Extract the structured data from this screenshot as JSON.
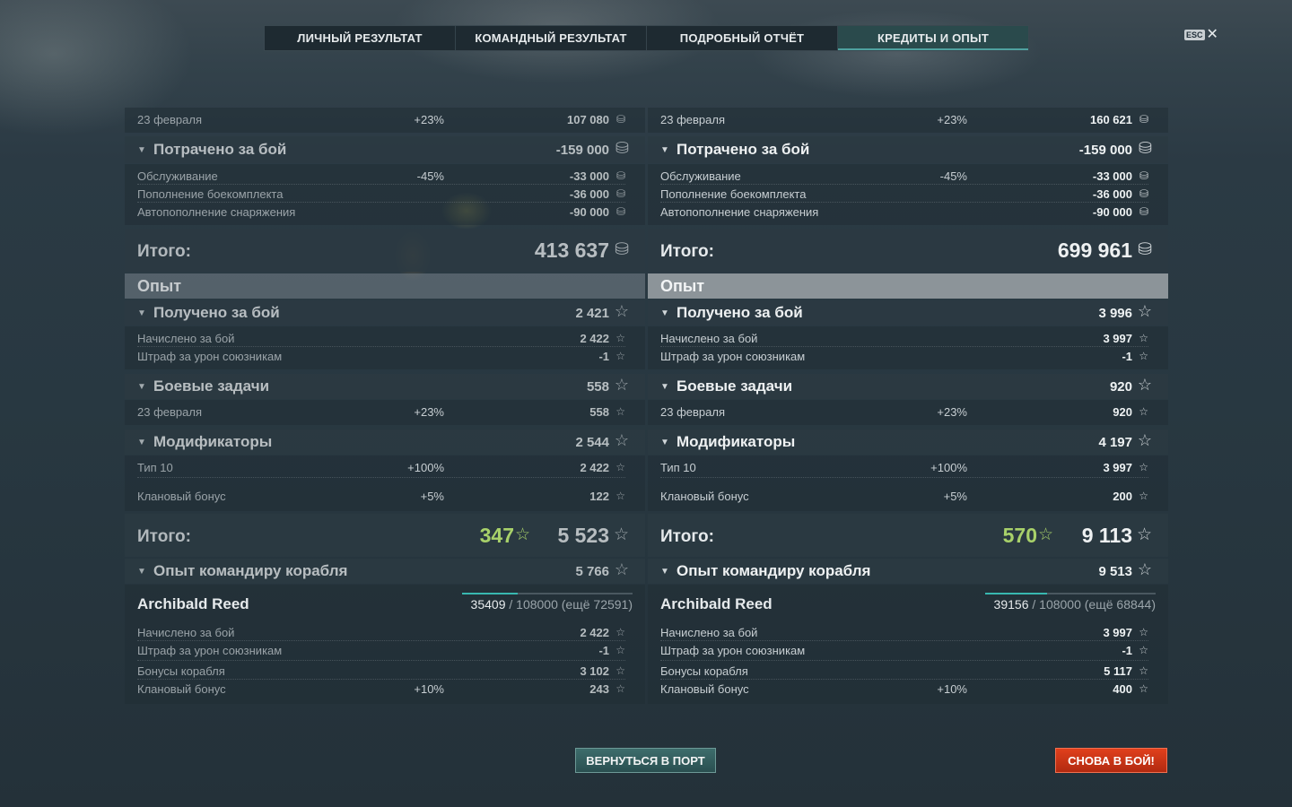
{
  "tabs": [
    {
      "label": "ЛИЧНЫЙ РЕЗУЛЬТАТ"
    },
    {
      "label": "КОМАНДНЫЙ РЕЗУЛЬТАТ"
    },
    {
      "label": "ПОДРОБНЫЙ ОТЧЁТ"
    },
    {
      "label": "КРЕДИТЫ И ОПЫТ"
    }
  ],
  "active_tab": "КРЕДИТЫ И ОПЫТ",
  "esc": {
    "key": "ESC",
    "close": "✕"
  },
  "icons": {
    "credit": "credit-coin-icon",
    "xp": "xp-star-icon"
  },
  "left": {
    "feb23": {
      "label": "23 февраля",
      "pct": "+23%",
      "value": "107 080"
    },
    "spent": {
      "label": "Потрачено за бой",
      "value": "-159 000"
    },
    "service": {
      "label": "Обслуживание",
      "pct": "-45%",
      "value": "-33 000"
    },
    "ammo": {
      "label": "Пополнение боекомплекта",
      "value": "-36 000"
    },
    "consumables": {
      "label": "Автопополнение снаряжения",
      "value": "-90 000"
    },
    "credits_total": {
      "label": "Итого:",
      "value": "413 637"
    },
    "xp_section": "Опыт",
    "earned": {
      "label": "Получено за бой",
      "value": "2 421"
    },
    "accrued": {
      "label": "Начислено за бой",
      "value": "2 422"
    },
    "penalty": {
      "label": "Штраф за урон союзникам",
      "value": "-1"
    },
    "missions": {
      "label": "Боевые задачи",
      "value": "558"
    },
    "missions_feb23": {
      "label": "23 февраля",
      "pct": "+23%",
      "value": "558"
    },
    "modifiers": {
      "label": "Модификаторы",
      "value": "2 544"
    },
    "tier": {
      "label": "Тип 10",
      "pct": "+100%",
      "value": "2 422"
    },
    "clan": {
      "label": "Клановый бонус",
      "pct": "+5%",
      "value": "122"
    },
    "xp_total": {
      "label": "Итого:",
      "free_xp": "347",
      "value": "5 523"
    },
    "commander": {
      "label": "Опыт командиру корабля",
      "value": "5 766"
    },
    "captain": {
      "name": "Archibald Reed",
      "current": "35409",
      "rest": "/ 108000 (ещё 72591)",
      "progress": 0.3279
    },
    "c_accrued": {
      "label": "Начислено за бой",
      "value": "2 422"
    },
    "c_penalty": {
      "label": "Штраф за урон союзникам",
      "value": "-1"
    },
    "c_ship": {
      "label": "Бонусы корабля",
      "value": "3 102"
    },
    "c_clan": {
      "label": "Клановый бонус",
      "pct": "+10%",
      "value": "243"
    }
  },
  "right": {
    "feb23": {
      "label": "23 февраля",
      "pct": "+23%",
      "value": "160 621"
    },
    "spent": {
      "label": "Потрачено за бой",
      "value": "-159 000"
    },
    "service": {
      "label": "Обслуживание",
      "pct": "-45%",
      "value": "-33 000"
    },
    "ammo": {
      "label": "Пополнение боекомплекта",
      "value": "-36 000"
    },
    "consumables": {
      "label": "Автопополнение снаряжения",
      "value": "-90 000"
    },
    "credits_total": {
      "label": "Итого:",
      "value": "699 961"
    },
    "xp_section": "Опыт",
    "earned": {
      "label": "Получено за бой",
      "value": "3 996"
    },
    "accrued": {
      "label": "Начислено за бой",
      "value": "3 997"
    },
    "penalty": {
      "label": "Штраф за урон союзникам",
      "value": "-1"
    },
    "missions": {
      "label": "Боевые задачи",
      "value": "920"
    },
    "missions_feb23": {
      "label": "23 февраля",
      "pct": "+23%",
      "value": "920"
    },
    "modifiers": {
      "label": "Модификаторы",
      "value": "4 197"
    },
    "tier": {
      "label": "Тип 10",
      "pct": "+100%",
      "value": "3 997"
    },
    "clan": {
      "label": "Клановый бонус",
      "pct": "+5%",
      "value": "200"
    },
    "xp_total": {
      "label": "Итого:",
      "free_xp": "570",
      "value": "9 113"
    },
    "commander": {
      "label": "Опыт командиру корабля",
      "value": "9 513"
    },
    "captain": {
      "name": "Archibald Reed",
      "current": "39156",
      "rest": "/ 108000 (ещё 68844)",
      "progress": 0.3626
    },
    "c_accrued": {
      "label": "Начислено за бой",
      "value": "3 997"
    },
    "c_penalty": {
      "label": "Штраф за урон союзникам",
      "value": "-1"
    },
    "c_ship": {
      "label": "Бонусы корабля",
      "value": "5 117"
    },
    "c_clan": {
      "label": "Клановый бонус",
      "pct": "+10%",
      "value": "400"
    }
  },
  "buttons": {
    "port": "ВЕРНУТЬСЯ В ПОРТ",
    "battle": "СНОВА В БОЙ!"
  }
}
